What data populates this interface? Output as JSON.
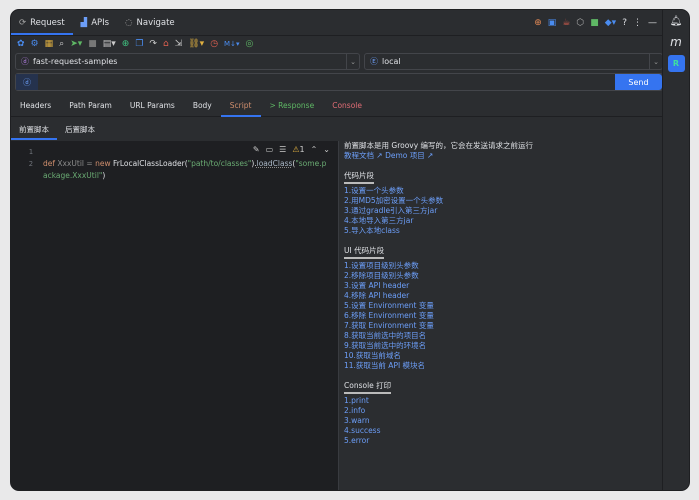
{
  "top_tabs": [
    {
      "label": "Request",
      "icon": "request-icon"
    },
    {
      "label": "APIs",
      "icon": "chart-icon"
    },
    {
      "label": "Navigate",
      "icon": "navigate-icon"
    }
  ],
  "right_icons": [
    "upload-icon",
    "bot-icon",
    "coffee-icon",
    "hexagon-icon",
    "green-square-icon",
    "cube-icon",
    "?",
    "⋮",
    "—"
  ],
  "project": {
    "value": "fast-request-samples"
  },
  "env": {
    "value": "local"
  },
  "url": {
    "value": "",
    "send_label": "Send"
  },
  "tabs": [
    {
      "label": "Headers",
      "color": "#dfe1e5"
    },
    {
      "label": "Path Param",
      "color": "#dfe1e5"
    },
    {
      "label": "URL Params",
      "color": "#dfe1e5"
    },
    {
      "label": "Body",
      "color": "#dfe1e5"
    },
    {
      "label": "Script",
      "color": "#cf8e6d",
      "active": true
    },
    {
      "label": "> Response",
      "color": "#5fb865"
    },
    {
      "label": "Console",
      "color": "#e06c75"
    }
  ],
  "subtabs": [
    "前置脚本",
    "后置脚本"
  ],
  "editor": {
    "lines": [
      "1",
      "2"
    ],
    "warning_count": "1",
    "code": {
      "kw1": "def",
      "var": " XxxUtil = ",
      "kw2": "new",
      "cls": " FrLocalClassLoader(",
      "s1": "\"path/to/classes\"",
      "p1": ").",
      "m": "loadClass",
      "p2": "(",
      "s2": "\"some.p",
      "s3": "ackage.XxxUtil\"",
      "p3": ")"
    }
  },
  "help": {
    "intro": "前置脚本是用 Groovy 编写的，它会在发送请求之前运行",
    "links": [
      "教程文档 ↗",
      "Demo 项目 ↗"
    ],
    "sections": [
      {
        "title": "代码片段",
        "items": [
          "1.设置一个头参数",
          "2.用MD5加密设置一个头参数",
          "3.通过gradle引入第三方jar",
          "4.本地导入第三方jar",
          "5.导入本地class"
        ]
      },
      {
        "title": "UI 代码片段",
        "items": [
          "1.设置项目级别头参数",
          "2.移除项目级别头参数",
          "3.设置 API header",
          "4.移除 API header",
          "5.设置 Environment 变量",
          "6.移除 Environment 变量",
          "7.获取 Environment 变量",
          "8.获取当前选中的项目名",
          "9.获取当前选中的环境名",
          "10.获取当前域名",
          "11.获取当前 API 模块名"
        ]
      },
      {
        "title": "Console 打印",
        "items": [
          "1.print",
          "2.info",
          "3.warn",
          "4.success",
          "5.error"
        ]
      }
    ]
  },
  "sidebar": {
    "m_label": "m"
  },
  "colors": {
    "accent": "#3574f0",
    "link": "#6c9ef8"
  }
}
